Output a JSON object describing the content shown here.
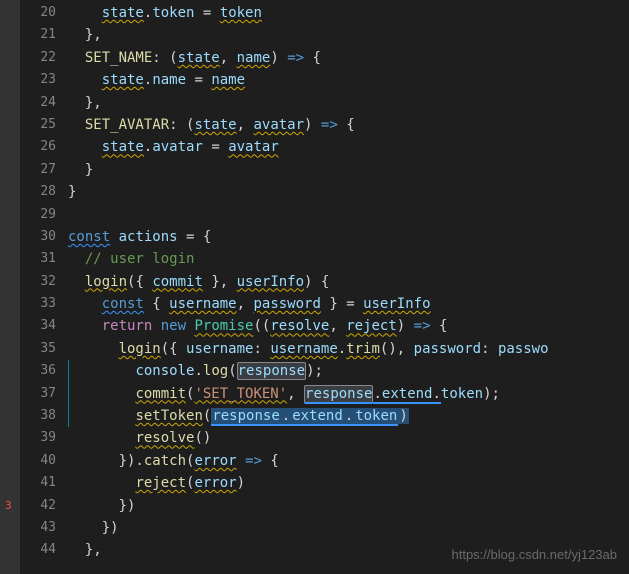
{
  "lines": {
    "20": {
      "num": "20",
      "indent": "    ",
      "tokens": [
        {
          "t": "state",
          "c": "prop wavy-yellow"
        },
        {
          "t": ".",
          "c": "punct"
        },
        {
          "t": "token",
          "c": "prop"
        },
        {
          "t": " = ",
          "c": "punct"
        },
        {
          "t": "token",
          "c": "var-name wavy-yellow"
        }
      ]
    },
    "21": {
      "num": "21",
      "indent": "  ",
      "tokens": [
        {
          "t": "},",
          "c": "punct"
        }
      ]
    },
    "22": {
      "num": "22",
      "indent": "  ",
      "fold": true,
      "tokens": [
        {
          "t": "SET_NAME",
          "c": "func-name"
        },
        {
          "t": ": (",
          "c": "punct"
        },
        {
          "t": "state",
          "c": "param wavy-yellow"
        },
        {
          "t": ", ",
          "c": "punct"
        },
        {
          "t": "name",
          "c": "param wavy-yellow"
        },
        {
          "t": ") ",
          "c": "punct"
        },
        {
          "t": "=>",
          "c": "const-kw"
        },
        {
          "t": " {",
          "c": "punct"
        }
      ]
    },
    "23": {
      "num": "23",
      "indent": "    ",
      "tokens": [
        {
          "t": "state",
          "c": "prop wavy-yellow"
        },
        {
          "t": ".",
          "c": "punct"
        },
        {
          "t": "name",
          "c": "prop"
        },
        {
          "t": " = ",
          "c": "punct"
        },
        {
          "t": "name",
          "c": "var-name wavy-yellow"
        }
      ]
    },
    "24": {
      "num": "24",
      "indent": "  ",
      "tokens": [
        {
          "t": "},",
          "c": "punct"
        }
      ]
    },
    "25": {
      "num": "25",
      "indent": "  ",
      "fold": true,
      "tokens": [
        {
          "t": "SET_AVATAR",
          "c": "func-name"
        },
        {
          "t": ": (",
          "c": "punct"
        },
        {
          "t": "state",
          "c": "param wavy-yellow"
        },
        {
          "t": ", ",
          "c": "punct"
        },
        {
          "t": "avatar",
          "c": "param wavy-yellow"
        },
        {
          "t": ") ",
          "c": "punct"
        },
        {
          "t": "=>",
          "c": "const-kw"
        },
        {
          "t": " {",
          "c": "punct"
        }
      ]
    },
    "26": {
      "num": "26",
      "indent": "    ",
      "tokens": [
        {
          "t": "state",
          "c": "prop wavy-yellow"
        },
        {
          "t": ".",
          "c": "punct"
        },
        {
          "t": "avatar",
          "c": "prop"
        },
        {
          "t": " = ",
          "c": "punct"
        },
        {
          "t": "avatar",
          "c": "var-name wavy-yellow"
        }
      ]
    },
    "27": {
      "num": "27",
      "indent": "  ",
      "tokens": [
        {
          "t": "}",
          "c": "punct"
        }
      ]
    },
    "28": {
      "num": "28",
      "indent": "",
      "tokens": [
        {
          "t": "}",
          "c": "punct"
        }
      ]
    },
    "29": {
      "num": "29",
      "indent": "",
      "tokens": []
    },
    "30": {
      "num": "30",
      "indent": "",
      "fold": true,
      "tokens": [
        {
          "t": "const",
          "c": "const-kw wavy-blue"
        },
        {
          "t": " ",
          "c": ""
        },
        {
          "t": "actions",
          "c": "var-name"
        },
        {
          "t": " = {",
          "c": "punct"
        }
      ]
    },
    "31": {
      "num": "31",
      "indent": "  ",
      "tokens": [
        {
          "t": "// user login",
          "c": "comment"
        }
      ]
    },
    "32": {
      "num": "32",
      "indent": "  ",
      "fold": true,
      "tokens": [
        {
          "t": "login",
          "c": "func-name wavy-yellow"
        },
        {
          "t": "({ ",
          "c": "punct"
        },
        {
          "t": "commit",
          "c": "var-name wavy-yellow"
        },
        {
          "t": " }, ",
          "c": "punct"
        },
        {
          "t": "userInfo",
          "c": "param wavy-yellow"
        },
        {
          "t": ") {",
          "c": "punct"
        }
      ]
    },
    "33": {
      "num": "33",
      "indent": "    ",
      "tokens": [
        {
          "t": "const",
          "c": "const-kw wavy-blue"
        },
        {
          "t": " { ",
          "c": "punct"
        },
        {
          "t": "username",
          "c": "var-name wavy-yellow"
        },
        {
          "t": ", ",
          "c": "punct"
        },
        {
          "t": "password",
          "c": "var-name wavy-yellow"
        },
        {
          "t": " } = ",
          "c": "punct"
        },
        {
          "t": "userInfo",
          "c": "var-name wavy-yellow"
        }
      ]
    },
    "34": {
      "num": "34",
      "indent": "    ",
      "fold": true,
      "tokens": [
        {
          "t": "return",
          "c": "keyword"
        },
        {
          "t": " ",
          "c": ""
        },
        {
          "t": "new",
          "c": "const-kw"
        },
        {
          "t": " ",
          "c": ""
        },
        {
          "t": "Promise",
          "c": "class-name wavy-yellow"
        },
        {
          "t": "((",
          "c": "punct"
        },
        {
          "t": "resolve",
          "c": "param wavy-yellow"
        },
        {
          "t": ", ",
          "c": "punct"
        },
        {
          "t": "reject",
          "c": "param wavy-yellow"
        },
        {
          "t": ") ",
          "c": "punct"
        },
        {
          "t": "=>",
          "c": "const-kw"
        },
        {
          "t": " {",
          "c": "punct"
        }
      ]
    },
    "35": {
      "num": "35",
      "indent": "      ",
      "fold": true,
      "tokens": [
        {
          "t": "login",
          "c": "func-name wavy-yellow"
        },
        {
          "t": "({ ",
          "c": "punct"
        },
        {
          "t": "username",
          "c": "prop"
        },
        {
          "t": ": ",
          "c": "punct"
        },
        {
          "t": "username",
          "c": "var-name wavy-yellow"
        },
        {
          "t": ".",
          "c": "punct"
        },
        {
          "t": "trim",
          "c": "func-name wavy-yellow"
        },
        {
          "t": "(), ",
          "c": "punct"
        },
        {
          "t": "password",
          "c": "prop"
        },
        {
          "t": ": ",
          "c": "punct"
        },
        {
          "t": "passwo",
          "c": "var-name"
        }
      ]
    },
    "36": {
      "num": "36",
      "indent": "        ",
      "change": true,
      "tokens": [
        {
          "t": "console",
          "c": "prop"
        },
        {
          "t": ".",
          "c": "punct"
        },
        {
          "t": "log",
          "c": "func-name"
        },
        {
          "t": "(",
          "c": "punct"
        },
        {
          "t": "response",
          "c": "var-name highlight-box"
        },
        {
          "t": ");",
          "c": "punct"
        }
      ]
    },
    "37": {
      "num": "37",
      "indent": "        ",
      "change": true,
      "tokens": [
        {
          "t": "commit",
          "c": "func-name wavy-yellow"
        },
        {
          "t": "(",
          "c": "punct"
        },
        {
          "t": "'SET_TOKEN'",
          "c": "string wavy-yellow"
        },
        {
          "t": ", ",
          "c": "punct"
        },
        {
          "t": "response",
          "c": "var-name highlight-box blue-underline"
        },
        {
          "t": ".",
          "c": "punct blue-underline"
        },
        {
          "t": "extend",
          "c": "prop blue-underline"
        },
        {
          "t": ".",
          "c": "punct blue-underline"
        },
        {
          "t": "token",
          "c": "prop"
        },
        {
          "t": ");",
          "c": "punct"
        }
      ]
    },
    "38": {
      "num": "38",
      "indent": "        ",
      "change": true,
      "tokens": [
        {
          "t": "setToken",
          "c": "func-name wavy-yellow"
        },
        {
          "t": "(",
          "c": "punct"
        },
        {
          "t": "response",
          "c": "var-name selection blue-underline"
        },
        {
          "t": ".",
          "c": "punct selection blue-underline"
        },
        {
          "t": "extend",
          "c": "prop selection blue-underline"
        },
        {
          "t": ".",
          "c": "punct selection blue-underline"
        },
        {
          "t": "token",
          "c": "prop selection blue-underline"
        },
        {
          "t": ")",
          "c": "punct selection"
        }
      ]
    },
    "39": {
      "num": "39",
      "indent": "        ",
      "tokens": [
        {
          "t": "resolve",
          "c": "func-name wavy-yellow"
        },
        {
          "t": "()",
          "c": "punct"
        }
      ]
    },
    "40": {
      "num": "40",
      "indent": "      ",
      "fold": true,
      "tokens": [
        {
          "t": "}).",
          "c": "punct"
        },
        {
          "t": "catch",
          "c": "func-name"
        },
        {
          "t": "(",
          "c": "punct"
        },
        {
          "t": "error",
          "c": "param wavy-yellow"
        },
        {
          "t": " ",
          "c": ""
        },
        {
          "t": "=>",
          "c": "const-kw"
        },
        {
          "t": " {",
          "c": "punct"
        }
      ]
    },
    "41": {
      "num": "41",
      "indent": "        ",
      "tokens": [
        {
          "t": "reject",
          "c": "func-name wavy-yellow"
        },
        {
          "t": "(",
          "c": "punct"
        },
        {
          "t": "error",
          "c": "var-name wavy-yellow"
        },
        {
          "t": ")",
          "c": "punct"
        }
      ]
    },
    "42": {
      "num": "42",
      "indent": "      ",
      "tokens": [
        {
          "t": "})",
          "c": "punct"
        }
      ]
    },
    "43": {
      "num": "43",
      "indent": "    ",
      "tokens": [
        {
          "t": "})",
          "c": "punct"
        }
      ]
    },
    "44": {
      "num": "44",
      "indent": "  ",
      "tokens": [
        {
          "t": "},",
          "c": "punct"
        }
      ]
    }
  },
  "watermark": "https://blog.csdn.net/yj123ab",
  "error_line": "3"
}
